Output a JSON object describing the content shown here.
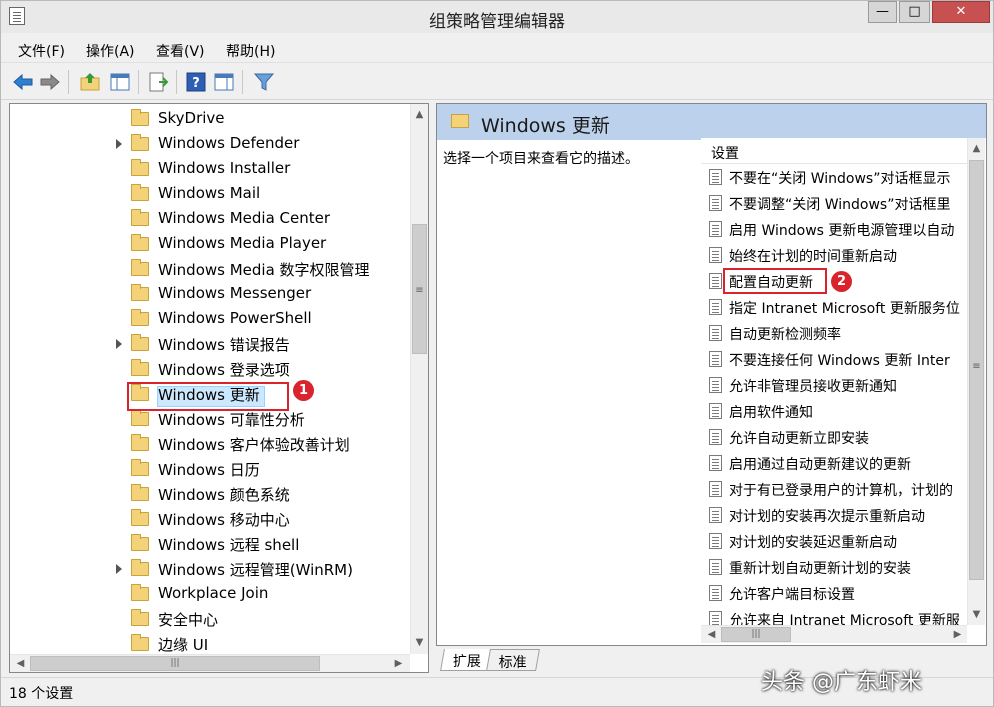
{
  "window": {
    "title": "组策略管理编辑器",
    "min_glyph": "—",
    "max_glyph": "□",
    "close_glyph": "✕"
  },
  "menu": [
    "文件(F)",
    "操作(A)",
    "查看(V)",
    "帮助(H)"
  ],
  "toolbar": {
    "icons": [
      "back-arrow-icon",
      "forward-arrow-icon",
      "up-folder-icon",
      "show-hide-tree-icon",
      "export-list-icon",
      "help-icon",
      "show-hide-action-pane-icon",
      "filter-icon"
    ]
  },
  "tree": {
    "items": [
      {
        "label": "SkyDrive",
        "expandable": false
      },
      {
        "label": "Windows Defender",
        "expandable": true
      },
      {
        "label": "Windows Installer",
        "expandable": false
      },
      {
        "label": "Windows Mail",
        "expandable": false
      },
      {
        "label": "Windows Media Center",
        "expandable": false
      },
      {
        "label": "Windows Media Player",
        "expandable": false
      },
      {
        "label": "Windows Media 数字权限管理",
        "expandable": false
      },
      {
        "label": "Windows Messenger",
        "expandable": false
      },
      {
        "label": "Windows PowerShell",
        "expandable": false
      },
      {
        "label": "Windows 错误报告",
        "expandable": true
      },
      {
        "label": "Windows 登录选项",
        "expandable": false
      },
      {
        "label": "Windows 更新",
        "expandable": false,
        "selected": true
      },
      {
        "label": "Windows 可靠性分析",
        "expandable": false
      },
      {
        "label": "Windows 客户体验改善计划",
        "expandable": false
      },
      {
        "label": "Windows 日历",
        "expandable": false
      },
      {
        "label": "Windows 颜色系统",
        "expandable": false
      },
      {
        "label": "Windows 移动中心",
        "expandable": false
      },
      {
        "label": "Windows 远程 shell",
        "expandable": false
      },
      {
        "label": "Windows 远程管理(WinRM)",
        "expandable": true
      },
      {
        "label": "Workplace Join",
        "expandable": false
      },
      {
        "label": "安全中心",
        "expandable": false
      },
      {
        "label": "边缘 UI",
        "expandable": false
      }
    ],
    "marker": "1"
  },
  "details": {
    "header_title": "Windows 更新",
    "description": "选择一个项目来查看它的描述。",
    "column_header": "设置",
    "rows": [
      "不要在“关闭 Windows”对话框显示",
      "不要调整“关闭 Windows”对话框里",
      "启用 Windows 更新电源管理以自动",
      "始终在计划的时间重新启动",
      "配置自动更新",
      "指定 Intranet Microsoft 更新服务位",
      "自动更新检测频率",
      "不要连接任何 Windows 更新 Inter",
      "允许非管理员接收更新通知",
      "启用软件通知",
      "允许自动更新立即安装",
      "启用通过自动更新建议的更新",
      "对于有已登录用户的计算机，计划的",
      "对计划的安装再次提示重新启动",
      "对计划的安装延迟重新启动",
      "重新计划自动更新计划的安装",
      "允许客户端目标设置",
      "允许来自 Intranet Microsoft 更新服"
    ],
    "marker": "2"
  },
  "tabs": [
    "扩展",
    "标准"
  ],
  "status": "18 个设置",
  "watermark": "头条 @广东虾米",
  "scroll": {
    "up": "▲",
    "down": "▼",
    "left": "◀",
    "right": "▶",
    "grip": "≡",
    "hgrip": "|||"
  }
}
